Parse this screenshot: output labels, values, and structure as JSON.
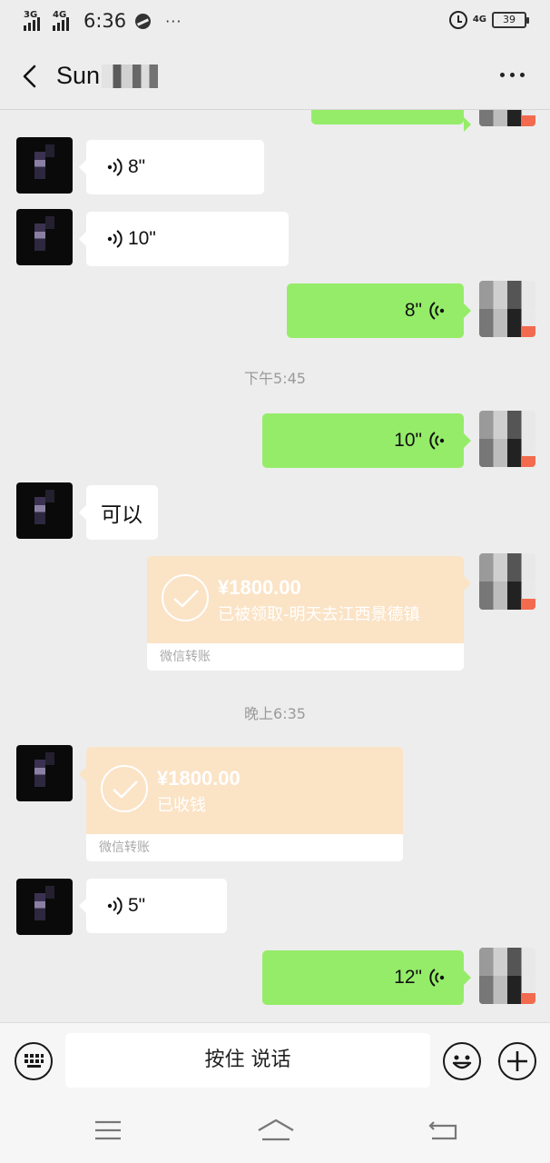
{
  "status_bar": {
    "network1": "3G",
    "network2": "4G",
    "time": "6:36",
    "more": "···",
    "network_right": "4G",
    "battery": "39"
  },
  "header": {
    "contact_name": "Sun"
  },
  "messages": {
    "m1": {
      "duration": "8\""
    },
    "m2": {
      "duration": "10\""
    },
    "m3": {
      "duration": "8\""
    },
    "ts1": "下午5:45",
    "m4": {
      "duration": "10\""
    },
    "m5": {
      "text": "可以"
    },
    "m6": {
      "amount": "¥1800.00",
      "desc": "已被领取-明天去江西景德镇",
      "footer": "微信转账"
    },
    "ts2": "晚上6:35",
    "m7": {
      "amount": "¥1800.00",
      "desc": "已收钱",
      "footer": "微信转账"
    },
    "m8": {
      "duration": "5\""
    },
    "m9": {
      "duration": "12\""
    }
  },
  "input_bar": {
    "hold_to_talk": "按住 说话"
  },
  "colors": {
    "bubble_out": "#95ec69",
    "bubble_in": "#ffffff",
    "transfer": "#fbe3c6",
    "background": "#ededed"
  },
  "icons": {
    "keyboard": "keyboard-icon",
    "emoji": "emoji-icon",
    "plus": "plus-icon",
    "back": "back-arrow-icon",
    "menu": "more-icon",
    "voice": "voice-wave-icon"
  }
}
